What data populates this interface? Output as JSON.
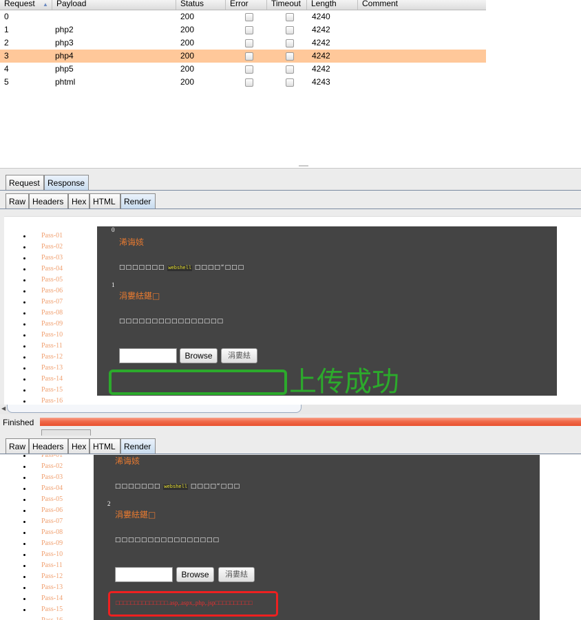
{
  "results": {
    "columns": [
      "Request",
      "Payload",
      "Status",
      "Error",
      "Timeout",
      "Length",
      "Comment"
    ],
    "rows": [
      {
        "request": "0",
        "payload": "",
        "status": "200",
        "length": "4240"
      },
      {
        "request": "1",
        "payload": "php2",
        "status": "200",
        "length": "4242"
      },
      {
        "request": "2",
        "payload": "php3",
        "status": "200",
        "length": "4242"
      },
      {
        "request": "3",
        "payload": "php4",
        "status": "200",
        "length": "4242"
      },
      {
        "request": "4",
        "payload": "php5",
        "status": "200",
        "length": "4242"
      },
      {
        "request": "5",
        "payload": "phtml",
        "status": "200",
        "length": "4243"
      }
    ],
    "selected_row": 3
  },
  "tabs_top": [
    "Request",
    "Response"
  ],
  "subtabs": [
    "Raw",
    "Headers",
    "Hex",
    "HTML",
    "Render"
  ],
  "status_label": "Finished",
  "nav_items": [
    "Pass-01",
    "Pass-02",
    "Pass-03",
    "Pass-04",
    "Pass-05",
    "Pass-06",
    "Pass-07",
    "Pass-08",
    "Pass-09",
    "Pass-10",
    "Pass-11",
    "Pass-12",
    "Pass-13",
    "Pass-14",
    "Pass-15",
    "Pass-16"
  ],
  "render1": {
    "num0": "0",
    "heading1": "浠诲姟",
    "desc1_pre": "□□□□□□□",
    "desc1_kw": "webshell",
    "desc1_post": "□□□□“□□□",
    "num1": "1",
    "heading2": "涓婁紶鍖□",
    "desc2": "□□□□□□□□□□□□□□□□",
    "browse": "Browse",
    "upload": "涓婁紶",
    "success_text": "上传成功"
  },
  "render2": {
    "heading1": "浠诲姟",
    "desc1_pre": "□□□□□□□",
    "desc1_kw": "webshell",
    "desc1_post": "□□□□“□□□",
    "num1": "2",
    "heading2": "涓婁紶鍖□",
    "desc2": "□□□□□□□□□□□□□□□□",
    "browse": "Browse",
    "upload": "涓婁紶",
    "error_text": "□□□□□□□□□□□□□□.asp,.aspx,.php,.jsp□□□□□□□□□□"
  },
  "colors": {
    "selected_row": "#ffc89a",
    "success": "#2caa2c",
    "error_box": "#ee2020",
    "progress": "#f06a4a"
  }
}
